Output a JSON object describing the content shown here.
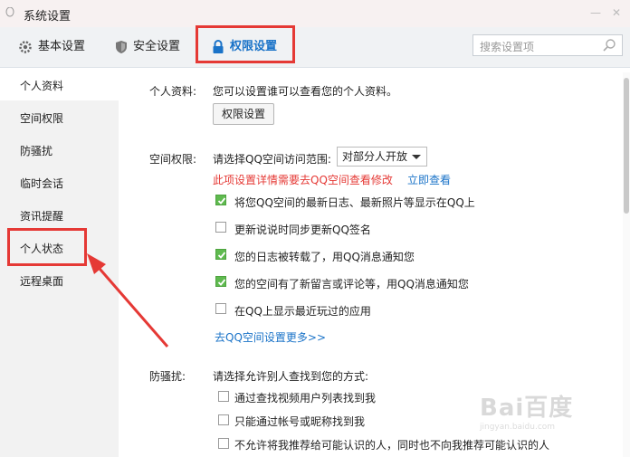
{
  "window": {
    "title": "系统设置",
    "min": "—",
    "close": "✕"
  },
  "tabs": [
    {
      "label": "基本设置",
      "icon": "gear-icon"
    },
    {
      "label": "安全设置",
      "icon": "shield-icon"
    },
    {
      "label": "权限设置",
      "icon": "lock-icon",
      "active": true
    }
  ],
  "search": {
    "placeholder": "搜索设置项",
    "icon": "search-icon"
  },
  "sidebar": {
    "items": [
      {
        "label": "个人资料",
        "selected": true
      },
      {
        "label": "空间权限"
      },
      {
        "label": "防骚扰"
      },
      {
        "label": "临时会话"
      },
      {
        "label": "资讯提醒"
      },
      {
        "label": "个人状态",
        "highlighted": true
      },
      {
        "label": "远程桌面"
      }
    ]
  },
  "profile": {
    "label": "个人资料:",
    "desc": "您可以设置谁可以查看您的个人资料。",
    "button": "权限设置"
  },
  "space": {
    "label": "空间权限:",
    "range_label": "请选择QQ空间访问范围:",
    "range_value": "对部分人开放",
    "warning": "此项设置详情需要去QQ空间查看修改",
    "view_link": "立即查看",
    "options": [
      {
        "label": "将您QQ空间的最新日志、最新照片等显示在QQ上",
        "checked": true
      },
      {
        "label": "更新说说时同步更新QQ签名",
        "checked": false
      },
      {
        "label": "您的日志被转载了，用QQ消息通知您",
        "checked": true
      },
      {
        "label": "您的空间有了新留言或评论等，用QQ消息通知您",
        "checked": true
      },
      {
        "label": "在QQ上显示最近玩过的应用",
        "checked": false
      }
    ],
    "more_link": "去QQ空间设置更多>>"
  },
  "harass": {
    "label": "防骚扰:",
    "desc": "请选择允许别人查找到您的方式:",
    "options": [
      {
        "label": "通过查找视频用户列表找到我",
        "checked": false
      },
      {
        "label": "只能通过帐号或昵称找到我",
        "checked": false
      },
      {
        "label": "不允许将我推荐给可能认识的人，同时也不向我推荐可能认识的人",
        "checked": false
      }
    ]
  },
  "watermark": {
    "main": "Bai百度",
    "sub": "jingyan.baidu.com"
  },
  "colors": {
    "accent": "#1a73c8",
    "highlight": "#e53935",
    "check": "#5fba4f"
  }
}
